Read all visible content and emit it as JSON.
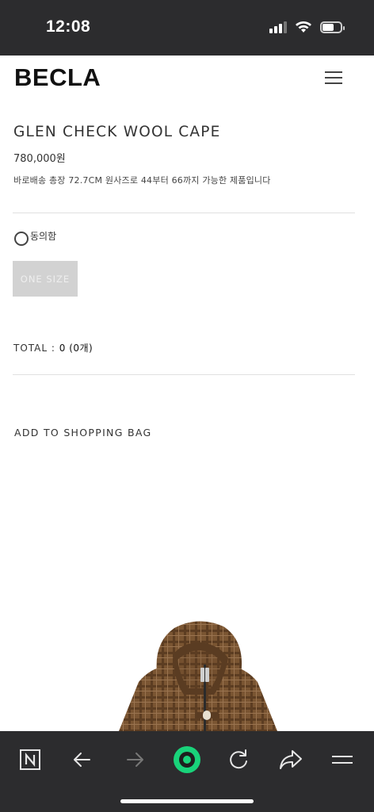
{
  "status_bar": {
    "time": "12:08",
    "battery_level": 0.65
  },
  "header": {
    "logo": "BECLA",
    "menu_icon": "hamburger-menu-icon"
  },
  "product": {
    "name": "GLEN CHECK WOOL CAPE",
    "price": "780,000원",
    "description": "바로배송 총장 72.7CM 원사즈로 44부터 66까지 가능한 제품입니다",
    "agree_label": "동의함",
    "agree_checked": false,
    "size_option": "ONE SIZE",
    "total_label": "TOTAL : ",
    "total_value": "0 (0개)",
    "add_to_bag": "ADD TO SHOPPING BAG",
    "image_icon": "product-photo-wool-cape"
  },
  "toolbar": {
    "icons": [
      "naver-n-icon",
      "back-arrow-icon",
      "forward-arrow-icon",
      "green-home-icon",
      "reload-icon",
      "share-icon",
      "menu-icon"
    ],
    "accent_color": "#19d37a"
  }
}
